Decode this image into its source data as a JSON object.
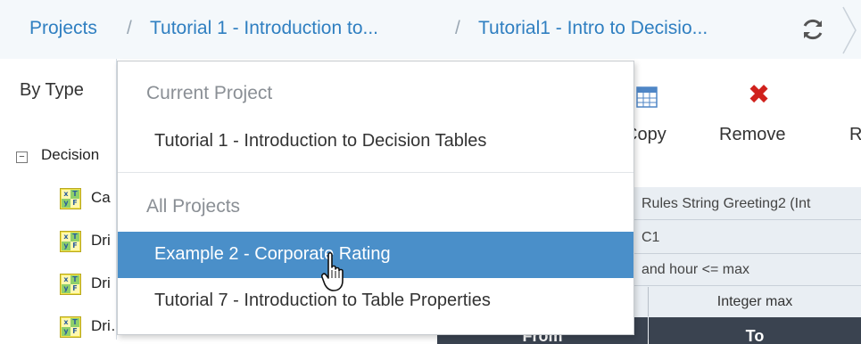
{
  "breadcrumb": {
    "items": [
      "Projects",
      "Tutorial 1 - Introduction to...",
      "Tutorial1 - Intro to Decisio..."
    ],
    "separator": "/"
  },
  "left_panel": {
    "view_label": "By Type",
    "tree_toggle": "−",
    "tree_root": "Decision",
    "tree_items": [
      "Ca",
      "Dri",
      "Dri",
      "Dri…ri…minute"
    ]
  },
  "toolbar": {
    "copy_label": "Copy",
    "remove_label": "Remove",
    "more_label": "R"
  },
  "grid": {
    "rows": [
      "Rules String Greeting2 (Int",
      "C1",
      "and hour <= max"
    ],
    "col_header": "Integer max",
    "head_from": "From",
    "head_to": "To"
  },
  "dropdown": {
    "current_group": "Current Project",
    "current_items": [
      "Tutorial 1 - Introduction to Decision Tables"
    ],
    "all_group": "All Projects",
    "all_items": [
      "Example 2 - Corporate Rating",
      "Tutorial 7 - Introduction to Table Properties"
    ],
    "selected_index": 0
  },
  "colors": {
    "link": "#2f7fc1",
    "selected": "#4a8fc9",
    "remove": "#d0211c"
  }
}
